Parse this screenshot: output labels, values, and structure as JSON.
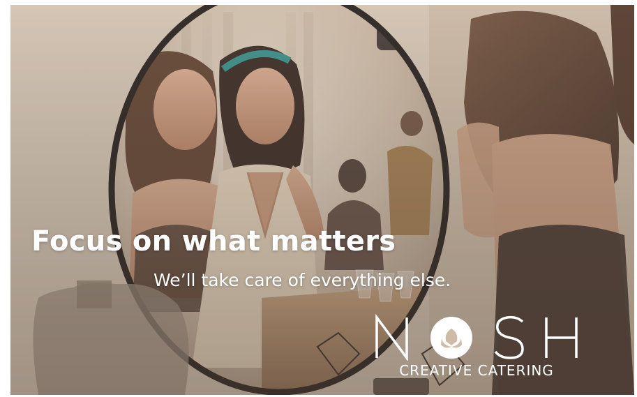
{
  "headline": "Focus on what matters",
  "subheadline": "We’ll take care of everything else.",
  "brand": {
    "logo_text": "NOSH",
    "tagline": "CREATIVE CATERING"
  },
  "colors": {
    "text": "#ffffff",
    "warm_tone": "#cdbba7"
  }
}
